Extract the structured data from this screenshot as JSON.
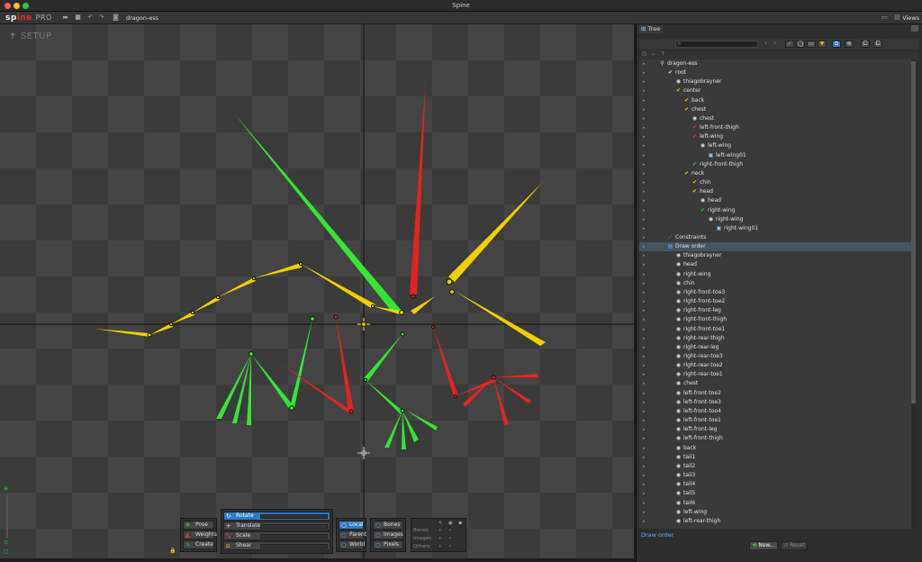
{
  "window": {
    "title": "Spine"
  },
  "toolbar": {
    "logo_main": "sp",
    "logo_mid": "ine",
    "logo_pro": "PRO",
    "project_name": "dragon-ess",
    "views_label": "Views"
  },
  "viewport": {
    "mode_label": "SETUP"
  },
  "tools": {
    "left": [
      {
        "label": "Pose",
        "icon": "pose-icon"
      },
      {
        "label": "Weights",
        "icon": "weights-icon"
      },
      {
        "label": "Create",
        "icon": "create-icon"
      }
    ],
    "transform": [
      {
        "label": "Rotate",
        "active": true
      },
      {
        "label": "Translate",
        "active": false
      },
      {
        "label": "Scale",
        "active": false
      },
      {
        "label": "Shear",
        "active": false
      }
    ],
    "axes": [
      {
        "label": "Local",
        "active": true
      },
      {
        "label": "Parent",
        "active": false
      },
      {
        "label": "World",
        "active": false
      }
    ],
    "compensate": [
      {
        "label": "Bones"
      },
      {
        "label": "Images"
      },
      {
        "label": "Pixels"
      }
    ],
    "visibility_rows": [
      "Bones",
      "Images",
      "Others"
    ]
  },
  "panel": {
    "tab_label": "Tree",
    "search_placeholder": "",
    "footer_label": "Draw order",
    "new_button": "New...",
    "reset_button": "Reset",
    "tree": [
      {
        "indent": 0,
        "icon": "skeleton-icon",
        "color": "#ddd",
        "label": "dragon-ess"
      },
      {
        "indent": 1,
        "icon": "bone-icon",
        "color": "#ddd",
        "label": "root"
      },
      {
        "indent": 2,
        "icon": "slot-icon",
        "color": "#ddd",
        "label": "thiagobrayner"
      },
      {
        "indent": 2,
        "icon": "bone-icon",
        "color": "#f0d000",
        "label": "center"
      },
      {
        "indent": 3,
        "icon": "bone-icon",
        "color": "#f0d000",
        "label": "back"
      },
      {
        "indent": 3,
        "icon": "bone-icon",
        "color": "#f0d000",
        "label": "chest"
      },
      {
        "indent": 4,
        "icon": "slot-icon",
        "color": "#ddd",
        "label": "chest"
      },
      {
        "indent": 4,
        "icon": "bone-icon",
        "color": "#e03030",
        "label": "left-front-thigh"
      },
      {
        "indent": 4,
        "icon": "bone-icon",
        "color": "#e03030",
        "label": "left-wing"
      },
      {
        "indent": 5,
        "icon": "slot-icon",
        "color": "#ddd",
        "label": "left-wing"
      },
      {
        "indent": 6,
        "icon": "attachment-icon",
        "color": "#8cc8ff",
        "label": "left-wing01"
      },
      {
        "indent": 4,
        "icon": "bone-icon",
        "color": "#30d030",
        "label": "right-front-thigh"
      },
      {
        "indent": 3,
        "icon": "bone-icon",
        "color": "#f0d000",
        "label": "neck"
      },
      {
        "indent": 4,
        "icon": "bone-icon",
        "color": "#f0d000",
        "label": "chin"
      },
      {
        "indent": 4,
        "icon": "bone-icon",
        "color": "#f0d000",
        "label": "head"
      },
      {
        "indent": 5,
        "icon": "slot-icon",
        "color": "#ddd",
        "label": "head"
      },
      {
        "indent": 5,
        "icon": "bone-icon",
        "color": "#30d030",
        "label": "right-wing"
      },
      {
        "indent": 6,
        "icon": "slot-icon",
        "color": "#ddd",
        "label": "right-wing"
      },
      {
        "indent": 7,
        "icon": "attachment-icon",
        "color": "#8cc8ff",
        "label": "right-wing01"
      },
      {
        "indent": 1,
        "icon": "constraint-icon",
        "color": "#e06060",
        "label": "Constraints"
      },
      {
        "indent": 1,
        "icon": "draworder-icon",
        "color": "#5bb0ff",
        "label": "Draw order",
        "selected": true
      },
      {
        "indent": 2,
        "icon": "slot-icon",
        "color": "#ddd",
        "label": "thiagobrayner"
      },
      {
        "indent": 2,
        "icon": "slot-icon",
        "color": "#ddd",
        "label": "head"
      },
      {
        "indent": 2,
        "icon": "slot-icon",
        "color": "#ddd",
        "label": "right-wing"
      },
      {
        "indent": 2,
        "icon": "slot-icon",
        "color": "#ddd",
        "label": "chin"
      },
      {
        "indent": 2,
        "icon": "slot-icon",
        "color": "#ddd",
        "label": "right-front-toe3"
      },
      {
        "indent": 2,
        "icon": "slot-icon",
        "color": "#ddd",
        "label": "right-front-toe2"
      },
      {
        "indent": 2,
        "icon": "slot-icon",
        "color": "#ddd",
        "label": "right-front-leg"
      },
      {
        "indent": 2,
        "icon": "slot-icon",
        "color": "#ddd",
        "label": "right-front-thigh"
      },
      {
        "indent": 2,
        "icon": "slot-icon",
        "color": "#ddd",
        "label": "right-front-toe1"
      },
      {
        "indent": 2,
        "icon": "slot-icon",
        "color": "#ddd",
        "label": "right-rear-thigh"
      },
      {
        "indent": 2,
        "icon": "slot-icon",
        "color": "#ddd",
        "label": "right-rear-leg"
      },
      {
        "indent": 2,
        "icon": "slot-icon",
        "color": "#ddd",
        "label": "right-rear-toe3"
      },
      {
        "indent": 2,
        "icon": "slot-icon",
        "color": "#ddd",
        "label": "right-rear-toe2"
      },
      {
        "indent": 2,
        "icon": "slot-icon",
        "color": "#ddd",
        "label": "right-rear-toe1"
      },
      {
        "indent": 2,
        "icon": "slot-icon",
        "color": "#ddd",
        "label": "chest"
      },
      {
        "indent": 2,
        "icon": "slot-icon",
        "color": "#ddd",
        "label": "left-front-toe2"
      },
      {
        "indent": 2,
        "icon": "slot-icon",
        "color": "#ddd",
        "label": "left-front-toe3"
      },
      {
        "indent": 2,
        "icon": "slot-icon",
        "color": "#ddd",
        "label": "left-front-toe4"
      },
      {
        "indent": 2,
        "icon": "slot-icon",
        "color": "#ddd",
        "label": "left-front-toe1"
      },
      {
        "indent": 2,
        "icon": "slot-icon",
        "color": "#ddd",
        "label": "left-front-leg"
      },
      {
        "indent": 2,
        "icon": "slot-icon",
        "color": "#ddd",
        "label": "left-front-thigh"
      },
      {
        "indent": 2,
        "icon": "slot-icon",
        "color": "#ddd",
        "label": "back"
      },
      {
        "indent": 2,
        "icon": "slot-icon",
        "color": "#ddd",
        "label": "tail1"
      },
      {
        "indent": 2,
        "icon": "slot-icon",
        "color": "#ddd",
        "label": "tail2"
      },
      {
        "indent": 2,
        "icon": "slot-icon",
        "color": "#ddd",
        "label": "tail3"
      },
      {
        "indent": 2,
        "icon": "slot-icon",
        "color": "#ddd",
        "label": "tail4"
      },
      {
        "indent": 2,
        "icon": "slot-icon",
        "color": "#ddd",
        "label": "tail5"
      },
      {
        "indent": 2,
        "icon": "slot-icon",
        "color": "#ddd",
        "label": "tail6"
      },
      {
        "indent": 2,
        "icon": "slot-icon",
        "color": "#ddd",
        "label": "left-wing"
      },
      {
        "indent": 2,
        "icon": "slot-icon",
        "color": "#ddd",
        "label": "left-rear-thigh"
      }
    ]
  },
  "colors": {
    "accent": "#2d7bc4",
    "bone_yellow": "#f0d000",
    "bone_green": "#30d030",
    "bone_red": "#e03030"
  }
}
